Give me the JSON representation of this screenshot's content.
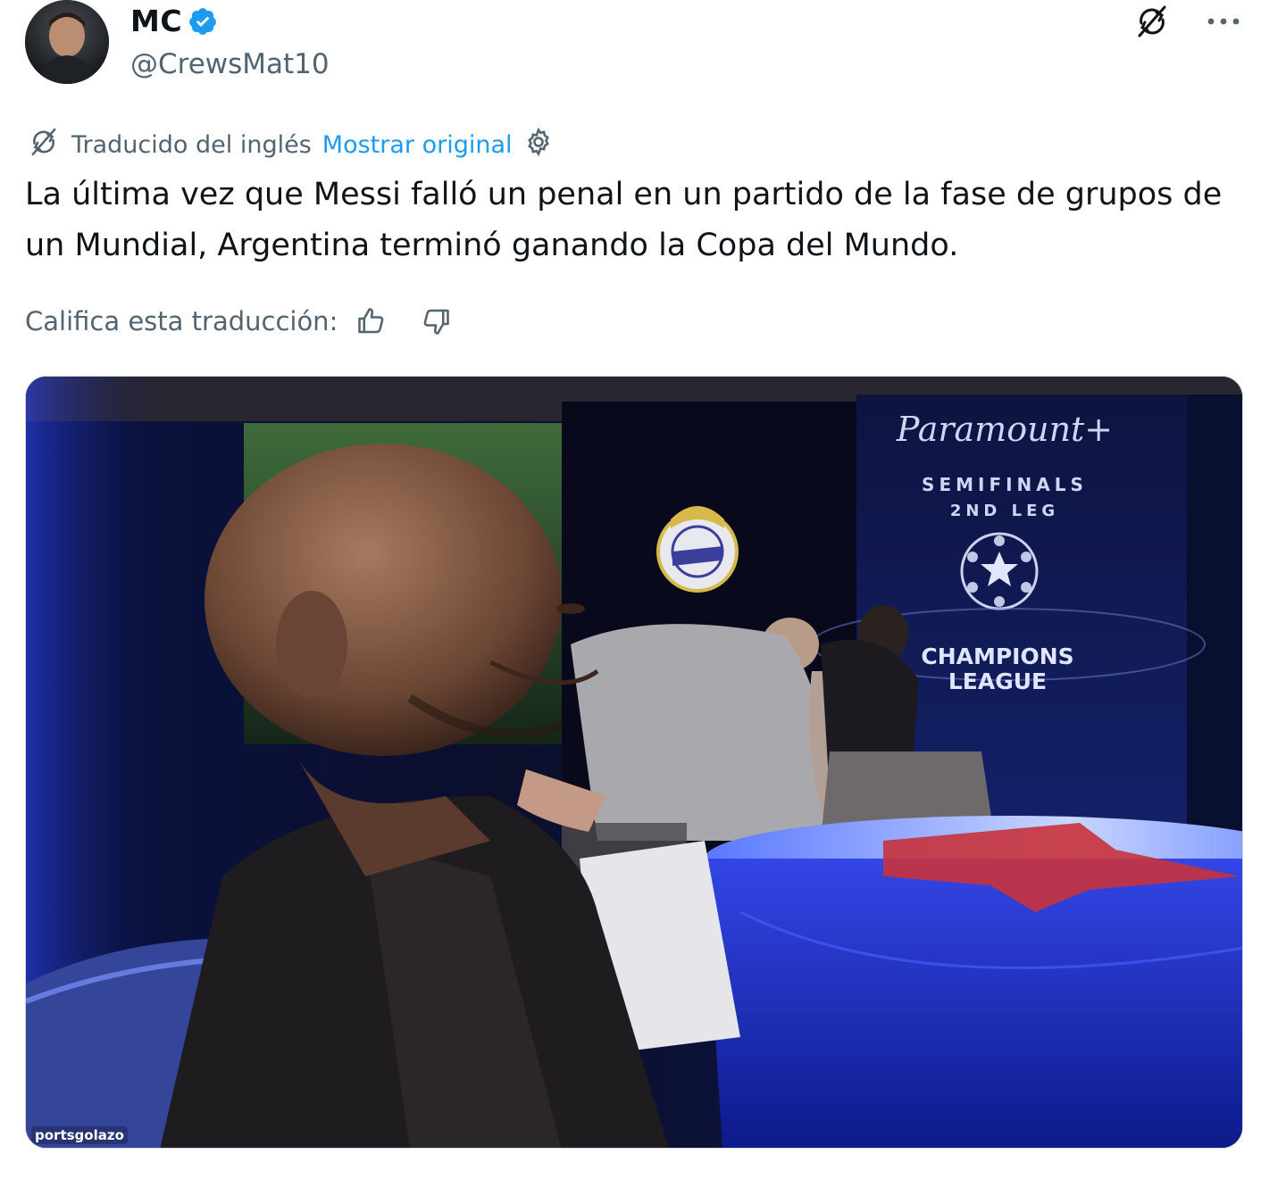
{
  "author": {
    "display_name": "MC",
    "handle": "@CrewsMat10",
    "verified": true
  },
  "actions": {
    "translate_icon": "translate-slash-icon",
    "more_icon": "more-horizontal-icon"
  },
  "translation": {
    "label": "Traducido del inglés",
    "show_original": "Mostrar original",
    "settings_icon": "gear-icon"
  },
  "tweet": {
    "text": "La última vez que Messi falló un penal en un partido de la fase de grupos de un Mundial, Argentina terminó ganando la Copa del Mundo."
  },
  "rating": {
    "prompt": "Califica esta traducción:",
    "up_icon": "thumbs-up-icon",
    "down_icon": "thumbs-down-icon"
  },
  "media": {
    "banner_brand": "Paramount+",
    "banner_line1": "SEMIFINALS",
    "banner_line2": "2ND LEG",
    "banner_line3": "CHAMPIONS",
    "banner_line4": "LEAGUE",
    "watermark": "portsgolazo",
    "colors": {
      "backdrop": "#0b0e2a",
      "accent_blue": "#2b3fd6",
      "star_red": "#c8323c"
    }
  }
}
